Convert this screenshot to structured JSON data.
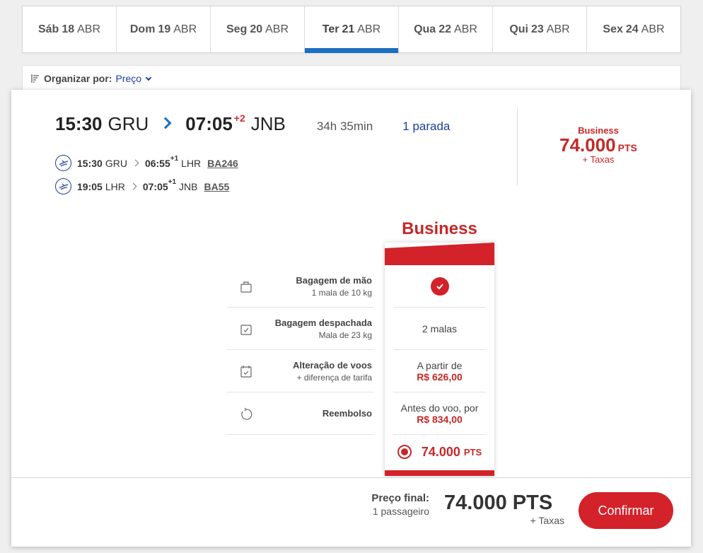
{
  "date_tabs": [
    {
      "weekday": "Sáb",
      "day": "18",
      "month": "ABR",
      "active": false
    },
    {
      "weekday": "Dom",
      "day": "19",
      "month": "ABR",
      "active": false
    },
    {
      "weekday": "Seg",
      "day": "20",
      "month": "ABR",
      "active": false
    },
    {
      "weekday": "Ter",
      "day": "21",
      "month": "ABR",
      "active": true
    },
    {
      "weekday": "Qua",
      "day": "22",
      "month": "ABR",
      "active": false
    },
    {
      "weekday": "Qui",
      "day": "23",
      "month": "ABR",
      "active": false
    },
    {
      "weekday": "Sex",
      "day": "24",
      "month": "ABR",
      "active": false
    }
  ],
  "sort": {
    "label": "Organizar por:",
    "value": "Preço"
  },
  "flight": {
    "depart_time": "15:30",
    "depart_code": "GRU",
    "arrive_time": "07:05",
    "arrive_plus": "+2",
    "arrive_code": "JNB",
    "duration": "34h 35min",
    "stops": "1 parada",
    "legs": [
      {
        "dep_time": "15:30",
        "dep_code": "GRU",
        "arr_time": "06:55",
        "arr_plus": "+1",
        "arr_code": "LHR",
        "flight_no": "BA246"
      },
      {
        "dep_time": "19:05",
        "dep_code": "LHR",
        "arr_time": "07:05",
        "arr_plus": "+1",
        "arr_code": "JNB",
        "flight_no": "BA55"
      }
    ]
  },
  "price_summary": {
    "cabin": "Business",
    "amount": "74.000",
    "unit": "PTS",
    "taxes": "+ Taxas"
  },
  "fare": {
    "title": "Business",
    "features": [
      {
        "title": "Bagagem de mão",
        "sub": "1 mala de 10 kg",
        "icon": "hand-bag-icon"
      },
      {
        "title": "Bagagem despachada",
        "sub": "Mala de 23 kg",
        "icon": "checked-bag-icon"
      },
      {
        "title": "Alteração de voos",
        "sub": "+ diferença de tarifa",
        "icon": "calendar-change-icon"
      },
      {
        "title": "Reembolso",
        "sub": "",
        "icon": "refund-icon"
      }
    ],
    "values": {
      "hand_bag": "included",
      "checked_bag": "2 malas",
      "change_line1": "A partir de",
      "change_line2": "R$ 626,00",
      "refund_line1": "Antes do voo, por",
      "refund_line2": "R$ 834,00"
    },
    "price": "74.000",
    "price_unit": "PTS",
    "selected": true
  },
  "footer": {
    "label": "Preço final:",
    "passengers": "1 passageiro",
    "amount": "74.000 PTS",
    "taxes": "+ Taxas",
    "confirm": "Confirmar"
  },
  "colors": {
    "brand_red": "#d3222a",
    "accent_blue": "#1a6fc2",
    "link_blue": "#1a3f9c"
  }
}
